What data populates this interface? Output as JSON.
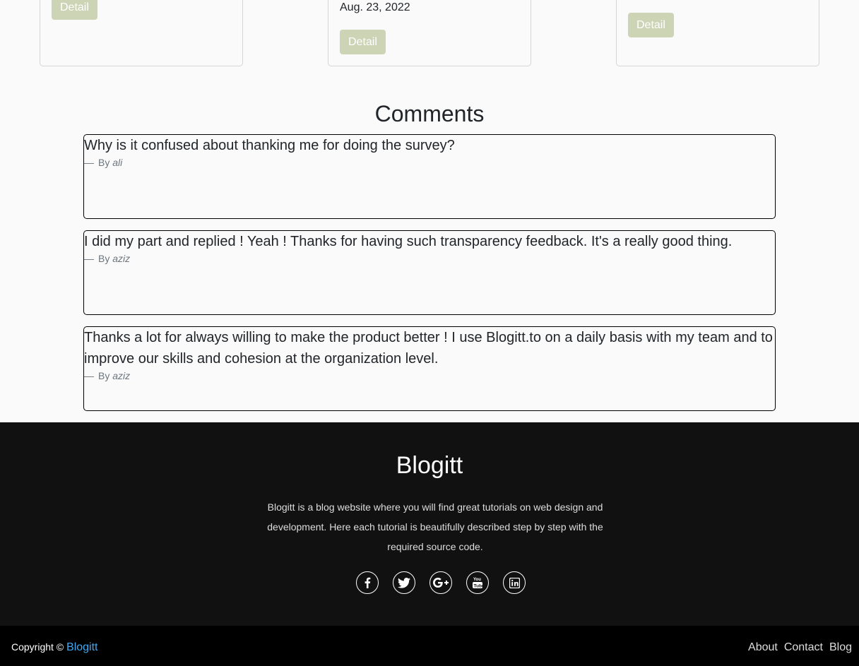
{
  "cards": [
    {
      "date": "",
      "button_label": "Detail"
    },
    {
      "date": "Aug. 23, 2022",
      "button_label": "Detail"
    },
    {
      "date": "",
      "button_label": "Detail"
    }
  ],
  "comments_section": {
    "heading": "Comments",
    "by_prefix": "By",
    "dash": "—",
    "items": [
      {
        "text": "Why is it confused about thanking me for doing the survey?",
        "author": "ali"
      },
      {
        "text": "I did my part and replied ! Yeah ! Thanks for having such transparency feedback. It's a really good thing.",
        "author": "aziz"
      },
      {
        "text": "Thanks a lot for always willing to make the product better ! I use Blogitt.to on a daily basis with my team and to improve our skills and cohesion at the organization level.",
        "author": "aziz"
      }
    ]
  },
  "footer": {
    "title": "Blogitt",
    "description": "Blogitt is a blog website where you will find great tutorials on web design and development. Here each tutorial is beautifully described step by step with the required source code.",
    "socials": [
      {
        "icon": "facebook-icon"
      },
      {
        "icon": "twitter-icon"
      },
      {
        "icon": "google-plus-icon"
      },
      {
        "icon": "youtube-icon"
      },
      {
        "icon": "linkedin-icon"
      }
    ]
  },
  "bottom_bar": {
    "copyright_text": "Copyright ©",
    "brand_link": "Blogitt",
    "links": [
      "About",
      "Contact",
      "Blog"
    ]
  },
  "colors": {
    "detail_button": "#cdd4b5",
    "footer_bg": "#111111",
    "bottom_bar_bg": "#000000",
    "brand_link": "#3fa9f5"
  }
}
